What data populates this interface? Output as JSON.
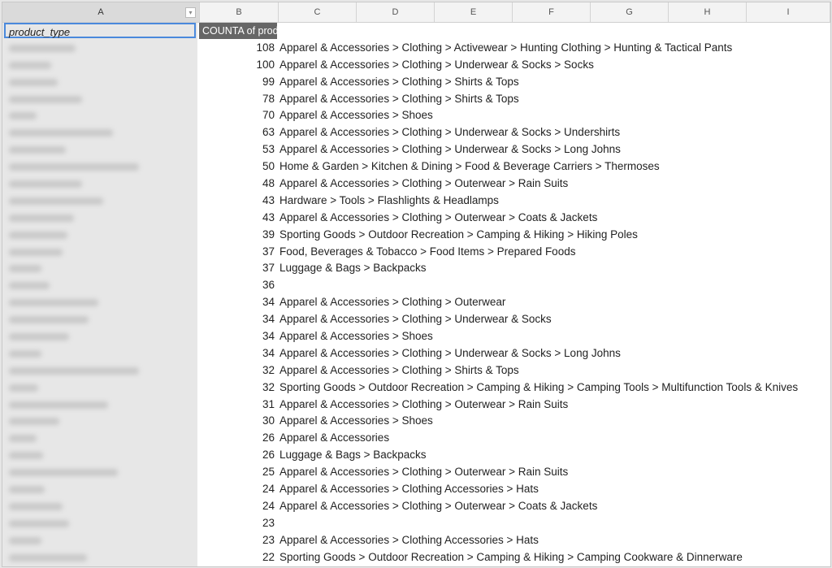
{
  "columns": [
    "A",
    "B",
    "C",
    "D",
    "E",
    "F",
    "G",
    "H",
    "I"
  ],
  "header": {
    "col_a": "product_type",
    "col_b": "COUNTA of prod"
  },
  "rows": [
    {
      "count": "108",
      "path": "Apparel & Accessories > Clothing > Activewear > Hunting Clothing > Hunting & Tactical Pants"
    },
    {
      "count": "100",
      "path": "Apparel & Accessories > Clothing > Underwear & Socks > Socks"
    },
    {
      "count": "99",
      "path": "Apparel & Accessories > Clothing > Shirts & Tops"
    },
    {
      "count": "78",
      "path": "Apparel & Accessories > Clothing > Shirts & Tops"
    },
    {
      "count": "70",
      "path": "Apparel & Accessories > Shoes"
    },
    {
      "count": "63",
      "path": "Apparel & Accessories > Clothing > Underwear & Socks > Undershirts"
    },
    {
      "count": "53",
      "path": "Apparel & Accessories > Clothing > Underwear & Socks > Long Johns"
    },
    {
      "count": "50",
      "path": "Home & Garden > Kitchen & Dining > Food & Beverage Carriers > Thermoses"
    },
    {
      "count": "48",
      "path": "Apparel & Accessories > Clothing > Outerwear > Rain Suits"
    },
    {
      "count": "43",
      "path": "Hardware > Tools > Flashlights & Headlamps"
    },
    {
      "count": "43",
      "path": "Apparel & Accessories > Clothing > Outerwear > Coats & Jackets"
    },
    {
      "count": "39",
      "path": "Sporting Goods > Outdoor Recreation > Camping & Hiking > Hiking Poles"
    },
    {
      "count": "37",
      "path": "Food, Beverages & Tobacco > Food Items > Prepared Foods"
    },
    {
      "count": "37",
      "path": "Luggage & Bags > Backpacks"
    },
    {
      "count": "36",
      "path": ""
    },
    {
      "count": "34",
      "path": "Apparel & Accessories > Clothing > Outerwear"
    },
    {
      "count": "34",
      "path": "Apparel & Accessories > Clothing > Underwear & Socks"
    },
    {
      "count": "34",
      "path": "Apparel & Accessories > Shoes"
    },
    {
      "count": "34",
      "path": "Apparel & Accessories > Clothing > Underwear & Socks > Long Johns"
    },
    {
      "count": "32",
      "path": "Apparel & Accessories > Clothing > Shirts & Tops"
    },
    {
      "count": "32",
      "path": "Sporting Goods > Outdoor Recreation > Camping & Hiking > Camping Tools > Multifunction Tools & Knives"
    },
    {
      "count": "31",
      "path": "Apparel & Accessories > Clothing > Outerwear > Rain Suits"
    },
    {
      "count": "30",
      "path": "Apparel & Accessories > Shoes"
    },
    {
      "count": "26",
      "path": "Apparel & Accessories"
    },
    {
      "count": "26",
      "path": "Luggage & Bags > Backpacks"
    },
    {
      "count": "25",
      "path": "Apparel & Accessories > Clothing > Outerwear > Rain Suits"
    },
    {
      "count": "24",
      "path": "Apparel & Accessories > Clothing Accessories > Hats"
    },
    {
      "count": "24",
      "path": "Apparel & Accessories > Clothing > Outerwear > Coats & Jackets"
    },
    {
      "count": "23",
      "path": ""
    },
    {
      "count": "23",
      "path": "Apparel & Accessories > Clothing Accessories > Hats"
    },
    {
      "count": "22",
      "path": "Sporting Goods > Outdoor Recreation > Camping & Hiking > Camping Cookware & Dinnerware"
    }
  ]
}
